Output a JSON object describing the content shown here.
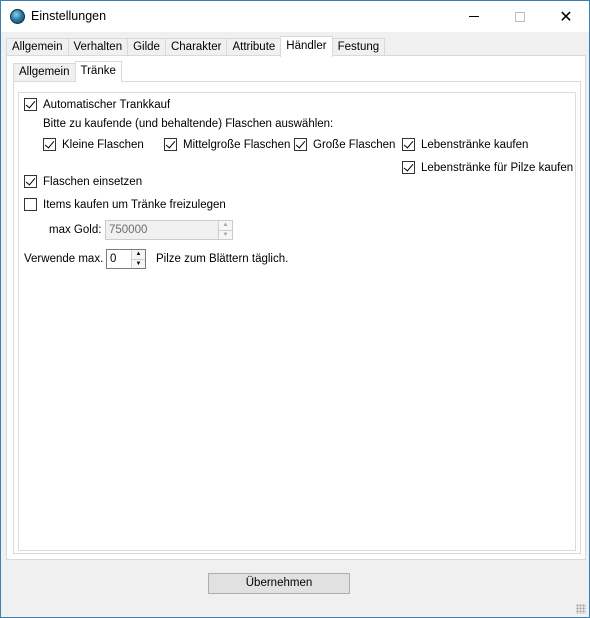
{
  "window": {
    "title": "Einstellungen"
  },
  "tabs": [
    "Allgemein",
    "Verhalten",
    "Gilde",
    "Charakter",
    "Attribute",
    "Händler",
    "Festung"
  ],
  "subtabs": [
    "Allgemein",
    "Tränke"
  ],
  "options": {
    "auto_buy": {
      "label": "Automatischer Trankkauf",
      "checked": true
    },
    "instruction": "Bitte zu kaufende (und behaltende) Flaschen auswählen:",
    "small": {
      "label": "Kleine Flaschen",
      "checked": true
    },
    "medium": {
      "label": "Mittelgroße Flaschen",
      "checked": true
    },
    "large": {
      "label": "Große Flaschen",
      "checked": true
    },
    "life": {
      "label": "Lebenstränke kaufen",
      "checked": true
    },
    "life_mushroom": {
      "label": "Lebenstränke für Pilze kaufen",
      "checked": true
    },
    "use_bottles": {
      "label": "Flaschen einsetzen",
      "checked": true
    },
    "buy_items": {
      "label": "Items kaufen um Tränke freizulegen",
      "checked": false
    },
    "max_gold_label": "max Gold:",
    "max_gold_value": "750000",
    "use_max_label": "Verwende max.",
    "use_max_value": "0",
    "mushroom_label": "Pilze zum Blättern täglich."
  },
  "apply_label": "Übernehmen",
  "icons": {
    "app": "app-globe-icon",
    "minimize": "minimize-icon",
    "maximize": "maximize-icon",
    "close": "close-icon",
    "spin_up": "spin-up-icon",
    "spin_down": "spin-down-icon",
    "grip": "resize-grip-icon"
  }
}
